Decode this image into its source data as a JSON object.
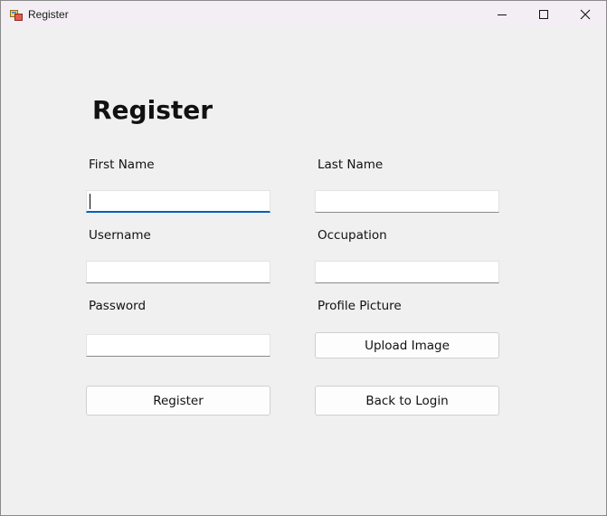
{
  "window": {
    "title": "Register",
    "icon": "app-icon"
  },
  "controls": {
    "minimize": "minimize-icon",
    "maximize": "maximize-icon",
    "close": "close-icon"
  },
  "form": {
    "heading": "Register",
    "first_name_label": "First Name",
    "last_name_label": "Last Name",
    "username_label": "Username",
    "occupation_label": "Occupation",
    "password_label": "Password",
    "profile_picture_label": "Profile Picture",
    "first_name_value": "",
    "last_name_value": "",
    "username_value": "",
    "occupation_value": "",
    "password_value": ""
  },
  "buttons": {
    "upload_image": "Upload Image",
    "register": "Register",
    "back_to_login": "Back to Login"
  },
  "colors": {
    "accent": "#005fb8",
    "background": "#f0f0f0",
    "titlebar": "#f3eef3"
  }
}
